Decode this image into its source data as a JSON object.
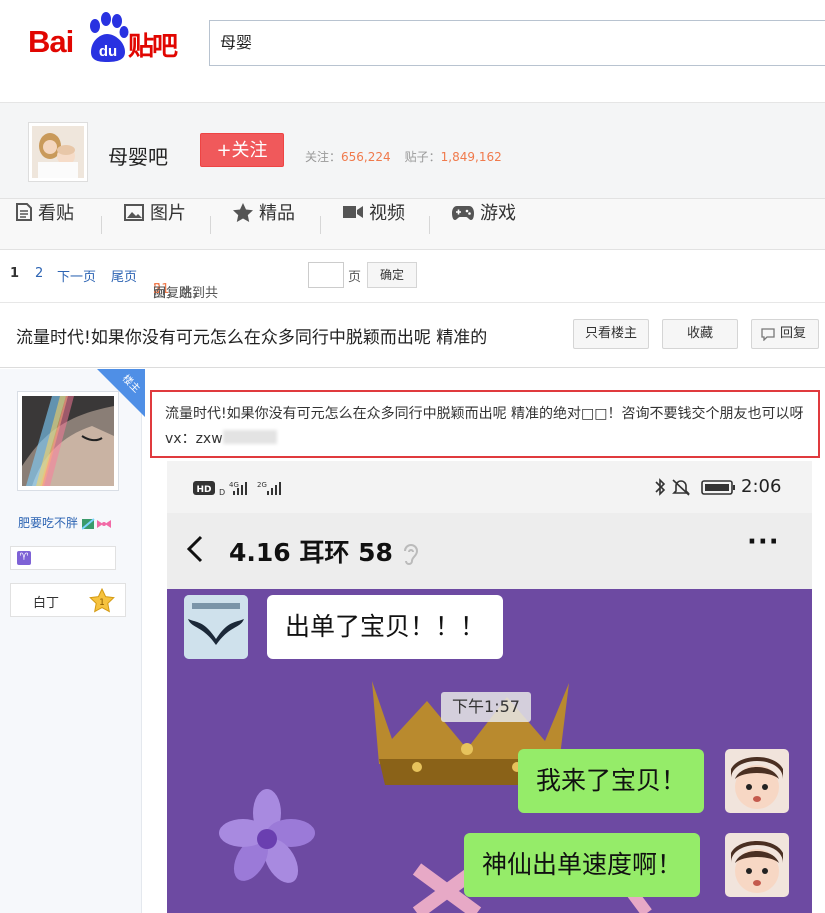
{
  "header": {
    "logo_bai": "Bai",
    "logo_du": "du",
    "logo_tieba": "贴吧",
    "search_value": "母婴"
  },
  "forum": {
    "name": "母婴吧",
    "follow_label": "+关注",
    "followers_label": "关注：",
    "followers_value": "656,224",
    "posts_label": "贴子：",
    "posts_value": "1,849,162"
  },
  "nav": {
    "items": [
      {
        "label": "看贴",
        "icon": "document-icon"
      },
      {
        "label": "图片",
        "icon": "image-icon"
      },
      {
        "label": "精品",
        "icon": "star-icon"
      },
      {
        "label": "视频",
        "icon": "video-camera-icon"
      },
      {
        "label": "游戏",
        "icon": "gamepad-icon"
      }
    ]
  },
  "pager": {
    "current": "1",
    "page2": "2",
    "next": "下一页",
    "last": "尾页",
    "replies_count": "51",
    "replies_text": "回复贴，共",
    "total_pages": "2",
    "pages_text": "页，跳到",
    "page_unit": "页",
    "confirm": "确定"
  },
  "thread": {
    "title": "流量时代!如果你没有可元怎么在众多同行中脱颖而出呢 精准的",
    "btn_only_op": "只看楼主",
    "btn_favorite": "收藏",
    "btn_reply": "回复"
  },
  "author": {
    "badge": "楼主",
    "name": "肥要吃不胖",
    "level_name": "白丁",
    "level_num": "1"
  },
  "post": {
    "text": "流量时代!如果你没有可元怎么在众多同行中脱颖而出呢 精准的绝对□□！咨询不要钱交个朋友也可以呀 vx：zxw"
  },
  "phone": {
    "status_left": "HD",
    "signal_1": "4G",
    "signal_2": "2G",
    "time": "2:06",
    "chat_title": "4.16 耳环 58",
    "more": "···",
    "timestamp": "下午1:57",
    "messages": [
      {
        "from": "other",
        "text": "出单了宝贝！！！"
      },
      {
        "from": "me",
        "text": "我来了宝贝！"
      },
      {
        "from": "me",
        "text": "神仙出单速度啊！"
      }
    ]
  },
  "colors": {
    "brand_red": "#e10601",
    "brand_blue": "#2932e1",
    "follow_button": "#f0595b",
    "link_blue": "#2d64b3",
    "highlight_border": "#e03a3e",
    "chat_bg": "#6d4aa2",
    "wechat_green": "#95ec69"
  }
}
